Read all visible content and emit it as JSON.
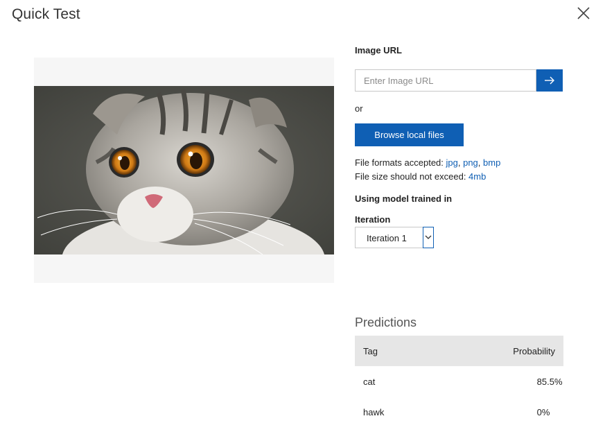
{
  "dialog": {
    "title": "Quick Test",
    "close_icon": "close-icon"
  },
  "image_url": {
    "label": "Image URL",
    "placeholder": "Enter Image URL",
    "value": "",
    "submit_icon": "arrow-right-icon"
  },
  "or_text": "or",
  "browse": {
    "label": "Browse local files"
  },
  "file_info": {
    "formats_prefix": "File formats accepted: ",
    "formats": [
      "jpg",
      "png",
      "bmp"
    ],
    "size_prefix": "File size should not exceed: ",
    "size_limit": "4mb"
  },
  "model": {
    "heading": "Using model trained in",
    "iteration_label": "Iteration",
    "iteration_value": "Iteration 1"
  },
  "predictions": {
    "title": "Predictions",
    "columns": [
      "Tag",
      "Probability"
    ],
    "rows": [
      {
        "tag": "cat",
        "probability": "85.5%"
      },
      {
        "tag": "hawk",
        "probability": "0%"
      }
    ]
  },
  "colors": {
    "accent": "#0f5fb4",
    "table_header_bg": "#e6e6e6",
    "preview_bg": "#f6f6f6"
  }
}
